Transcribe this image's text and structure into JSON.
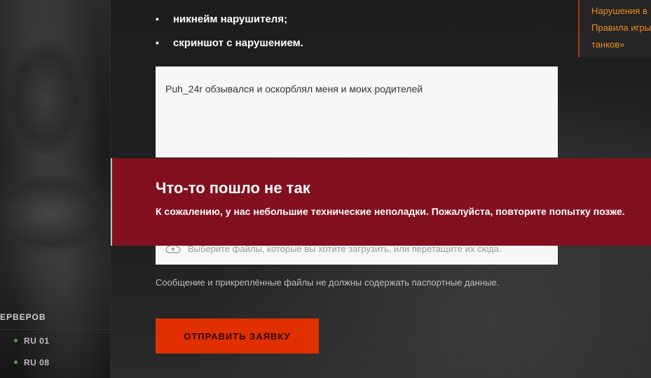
{
  "bullets": [
    "никнейм нарушителя;",
    "скриншот с нарушением."
  ],
  "message": {
    "value": "Puh_24r обзывался и оскорблял меня и моих родителей"
  },
  "upload": {
    "hint": "Выберите файлы, которые вы хотите загрузить, или перетащите их сюда.",
    "icon": "cloud-upload-icon"
  },
  "note": "Сообщение и прикреплённые файлы не должны содержать паспортные данные.",
  "submit_label": "ОТПРАВИТЬ ЗАЯВКУ",
  "side_links": [
    "Нарушения в",
    "Правила игры",
    "танков»"
  ],
  "error": {
    "title": "Что-то пошло не так",
    "text": "К сожалению, у нас небольшие технические неполадки. Пожалуйста, повторите попытку позже."
  },
  "servers": {
    "title": "ЕРВЕРОВ",
    "items": [
      {
        "label": "RU 01",
        "status_color": "#49a339"
      },
      {
        "label": "RU 08",
        "status_color": "#49a339"
      }
    ]
  },
  "colors": {
    "accent": "#e03000",
    "error_bg": "#82101f",
    "link": "#f08a1c"
  }
}
